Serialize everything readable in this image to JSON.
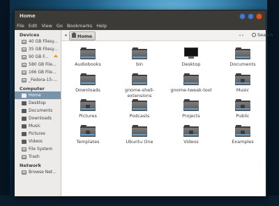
{
  "window": {
    "title": "Home",
    "colors": {
      "close": "#e2521d",
      "minimize": "#4a78c8",
      "maximize": "#4a78c8",
      "selection": "#7794aa",
      "folder_stripe": "#5ea4d6"
    }
  },
  "menu": [
    "File",
    "Edit",
    "View",
    "Go",
    "Bookmarks",
    "Help"
  ],
  "sidebar": {
    "devices_header": "Devices",
    "devices": [
      {
        "label": "40 GB Filesy...",
        "icon": "drive-icon"
      },
      {
        "label": "35 GB Filesy...",
        "icon": "drive-icon"
      },
      {
        "label": "90 GB F...",
        "icon": "drive-icon",
        "ejectable": true
      },
      {
        "label": "580 GB File...",
        "icon": "drive-icon"
      },
      {
        "label": "166 GB File...",
        "icon": "drive-icon"
      },
      {
        "label": "_Fedora-15-...",
        "icon": "drive-icon"
      }
    ],
    "computer_header": "Computer",
    "computer": [
      {
        "label": "Home",
        "icon": "home-icon"
      },
      {
        "label": "Desktop",
        "icon": "desktop-icon"
      },
      {
        "label": "Documents",
        "icon": "folder-icon"
      },
      {
        "label": "Downloads",
        "icon": "folder-icon"
      },
      {
        "label": "Music",
        "icon": "folder-icon"
      },
      {
        "label": "Pictures",
        "icon": "folder-icon"
      },
      {
        "label": "Videos",
        "icon": "folder-icon"
      },
      {
        "label": "File System",
        "icon": "drive-icon"
      },
      {
        "label": "Trash",
        "icon": "trash-icon"
      }
    ],
    "network_header": "Network",
    "network": [
      {
        "label": "Browse Net...",
        "icon": "network-icon"
      }
    ]
  },
  "toolbar": {
    "breadcrumb": "Home",
    "search_label": "Search"
  },
  "files": [
    {
      "label": "Audiobooks",
      "icon": "folder-icon"
    },
    {
      "label": "bin",
      "icon": "folder-icon"
    },
    {
      "label": "Desktop",
      "icon": "desktop-icon"
    },
    {
      "label": "Documents",
      "icon": "folder-icon"
    },
    {
      "label": "Downloads",
      "icon": "folder-icon"
    },
    {
      "label": "gnome-shell-extensions",
      "icon": "folder-icon"
    },
    {
      "label": "gnome-tweak-tool",
      "icon": "folder-icon"
    },
    {
      "label": "Music",
      "icon": "music-folder-icon"
    },
    {
      "label": "Pictures",
      "icon": "pictures-folder-icon"
    },
    {
      "label": "Podcasts",
      "icon": "folder-icon"
    },
    {
      "label": "Projects",
      "icon": "folder-icon"
    },
    {
      "label": "Public",
      "icon": "public-folder-icon"
    },
    {
      "label": "Templates",
      "icon": "templates-folder-icon"
    },
    {
      "label": "Ubuntu One",
      "icon": "folder-icon"
    },
    {
      "label": "Videos",
      "icon": "videos-folder-icon"
    },
    {
      "label": "Examples",
      "icon": "examples-folder-icon"
    }
  ]
}
